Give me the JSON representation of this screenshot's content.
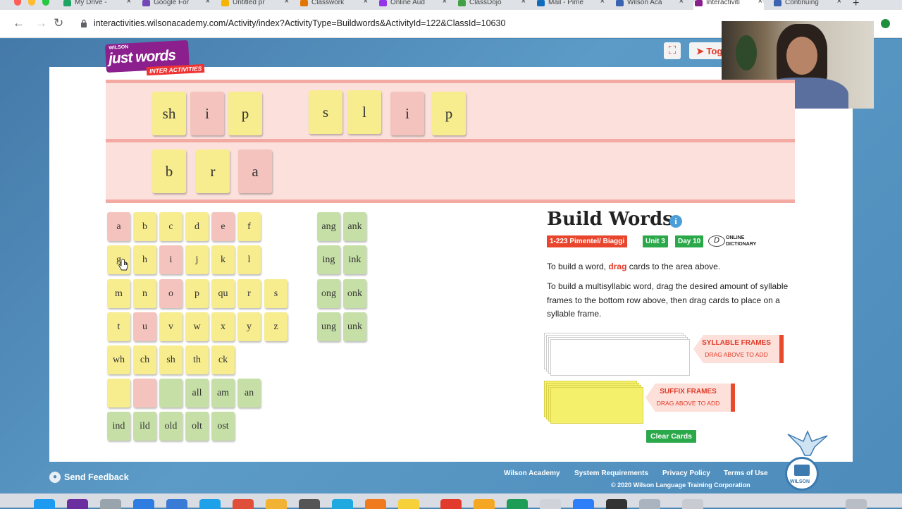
{
  "browser": {
    "tabs": [
      {
        "label": "My Drive -",
        "color": "#1fa463"
      },
      {
        "label": "Google For",
        "color": "#7248b9"
      },
      {
        "label": "Untitled pr",
        "color": "#f4b400"
      },
      {
        "label": "Classwork",
        "color": "#e37400"
      },
      {
        "label": "Online Aud",
        "color": "#9333ea"
      },
      {
        "label": "ClassDojo",
        "color": "#43a047"
      },
      {
        "label": "Mail - Pime",
        "color": "#0f6cbd"
      },
      {
        "label": "Wilson Aca",
        "color": "#3a63b0"
      },
      {
        "label": "Interactiviti",
        "color": "#8a1f8d"
      },
      {
        "label": "Continuing",
        "color": "#3a63b0"
      }
    ],
    "url": "interactivities.wilsonacademy.com/Activity/index?ActivityType=Buildwords&ActivityId=122&ClassId=10630"
  },
  "header": {
    "logo_top": "WILSON",
    "logo_main": "just words",
    "logo_sub": "INTER ACTIVITIES",
    "toggle_label": "Tog"
  },
  "build_rows": {
    "row1_word1": [
      "sh",
      "i",
      "p"
    ],
    "row1_word2": [
      "s",
      "l",
      "i",
      "p"
    ],
    "row2_word1": [
      "b",
      "r",
      "a"
    ]
  },
  "letter_cards": [
    "a",
    "b",
    "c",
    "d",
    "e",
    "f",
    "g",
    "h",
    "i",
    "j",
    "k",
    "l",
    "m",
    "n",
    "o",
    "p",
    "qu",
    "r",
    "s",
    "t",
    "u",
    "v",
    "w",
    "x",
    "y",
    "z",
    "wh",
    "ch",
    "sh",
    "th",
    "ck",
    "",
    "",
    "",
    "all",
    "am",
    "an",
    "ind",
    "ild",
    "old",
    "olt",
    "ost"
  ],
  "glued_cards": [
    "ang",
    "ank",
    "ing",
    "ink",
    "ong",
    "onk",
    "ung",
    "unk"
  ],
  "panel": {
    "title": "Build Words",
    "info": "i",
    "tags": [
      "1-223 Pimentel/ Biaggi",
      "Unit 3",
      "Day 10"
    ],
    "dictionary_line1": "ONLINE",
    "dictionary_line2": "DICTIONARY",
    "instr1_pre": "To build a word, ",
    "instr1_em": "drag",
    "instr1_post": " cards to the area above.",
    "instr2": "To build a multisyllabic word, drag the desired amount of syllable frames to the bottom row above, then drag cards to place on a syllable frame.",
    "syllable_title": "SYLLABLE FRAMES",
    "syllable_sub": "DRAG ABOVE TO ADD",
    "suffix_title": "SUFFIX FRAMES",
    "suffix_sub": "DRAG ABOVE TO ADD",
    "clear_label": "Clear Cards"
  },
  "footer": {
    "feedback": "Send Feedback",
    "links": [
      "Wilson Academy",
      "System Requirements",
      "Privacy Policy",
      "Terms of Use"
    ],
    "copyright": "© 2020 Wilson Language Training Corporation",
    "wilson_logo": "WILSON"
  },
  "colors": {
    "yellow_card": "#f7ec8e",
    "pink_card": "#f4c3bd",
    "green_card": "#c6dfa7",
    "accent_red": "#e03a2a",
    "tag_green": "#2aa84a"
  }
}
